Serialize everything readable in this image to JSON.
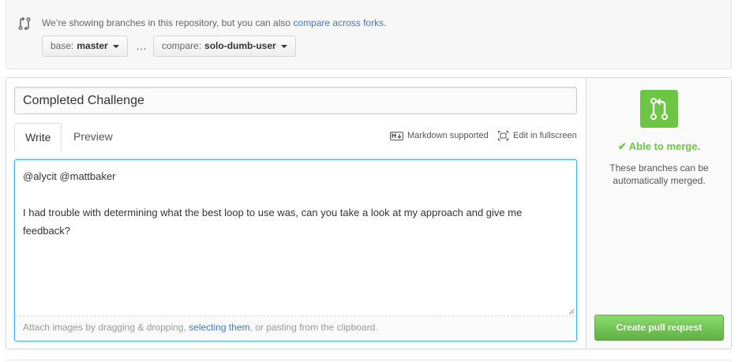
{
  "compare": {
    "note_prefix": "We’re showing branches in this repository, but you can also ",
    "note_link": "compare across forks",
    "note_suffix": ".",
    "base_prefix": "base:",
    "base_branch": "master",
    "separator": "…",
    "compare_prefix": "compare:",
    "compare_branch": "solo-dumb-user"
  },
  "form": {
    "title_value": "Completed Challenge",
    "tabs": [
      {
        "label": "Write",
        "active": true
      },
      {
        "label": "Preview",
        "active": false
      }
    ],
    "markdown_label": "Markdown supported",
    "fullscreen_label": "Edit in fullscreen",
    "body_text": "@alycit @mattbaker\n\nI had trouble with determining what the best loop to use was, can you take a look at my approach and give me feedback?",
    "attach_prefix": "Attach images by dragging & dropping, ",
    "attach_link": "selecting them",
    "attach_suffix": ", or pasting from the clipboard."
  },
  "sidebar": {
    "merge_status": "Able to merge.",
    "merge_description": "These branches can be automatically merged.",
    "create_button": "Create pull request"
  },
  "colors": {
    "accent_blue": "#4078c0",
    "merge_green": "#6cc644",
    "button_green": "#60b044",
    "focus_blue": "#51a7e8"
  },
  "icons": {
    "compare": "git-compare-icon",
    "caret": "caret-down-icon",
    "markdown": "markdown-icon",
    "fullscreen": "fullscreen-icon",
    "merge": "git-pull-request-icon",
    "check": "check-icon",
    "resize": "resize-handle-icon"
  }
}
